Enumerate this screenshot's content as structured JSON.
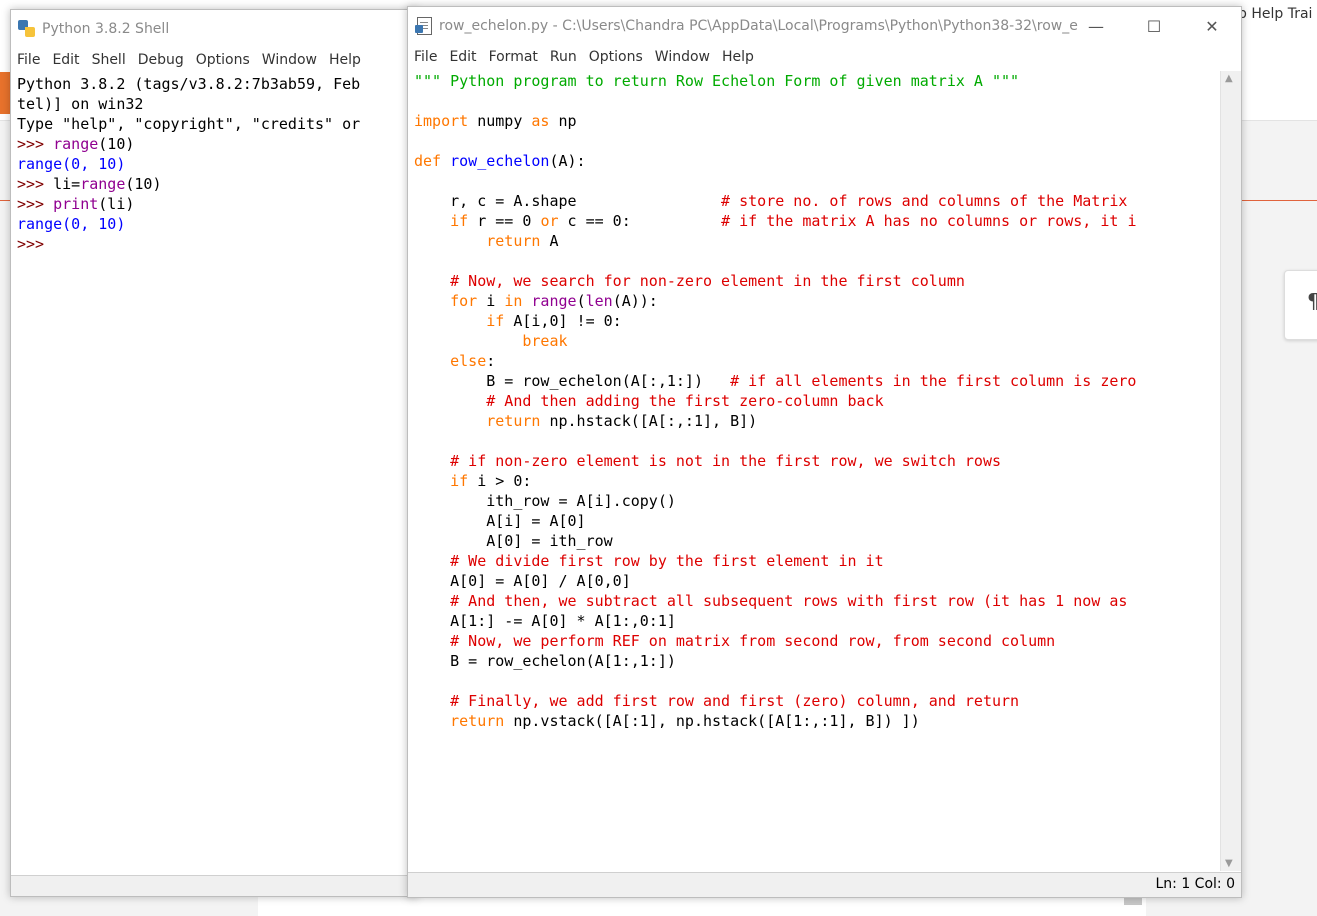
{
  "background": {
    "tab_partial": "p Help Trai",
    "pilcrow": "¶"
  },
  "shell": {
    "title": "Python 3.8.2 Shell",
    "menu": [
      "File",
      "Edit",
      "Shell",
      "Debug",
      "Options",
      "Window",
      "Help"
    ]
  },
  "editor": {
    "title": "row_echelon.py - C:\\Users\\Chandra PC\\AppData\\Local\\Programs\\Python\\Python38-32\\row_e...",
    "menu": [
      "File",
      "Edit",
      "Format",
      "Run",
      "Options",
      "Window",
      "Help"
    ],
    "status": "Ln: 1   Col: 0",
    "controls": {
      "minimize": "—",
      "maximize": "☐",
      "close": "✕"
    }
  },
  "shell_lines": [
    [
      [
        "",
        "Python 3.8.2 (tags/v3.8.2:7b3ab59, Feb"
      ]
    ],
    [
      [
        "",
        "tel)] on win32"
      ]
    ],
    [
      [
        "",
        "Type \"help\", \"copyright\", \"credits\" or"
      ]
    ],
    [
      [
        "pr",
        ">>> "
      ],
      [
        "bi",
        "range"
      ],
      [
        "",
        "(10)"
      ]
    ],
    [
      [
        "ou",
        "range(0, 10)"
      ]
    ],
    [
      [
        "pr",
        ">>> "
      ],
      [
        "",
        "li="
      ],
      [
        "bi",
        "range"
      ],
      [
        "",
        "(10)"
      ]
    ],
    [
      [
        "pr",
        ">>> "
      ],
      [
        "bi",
        "print"
      ],
      [
        "",
        "(li)"
      ]
    ],
    [
      [
        "ou",
        "range(0, 10)"
      ]
    ],
    [
      [
        "pr",
        ">>> "
      ]
    ]
  ],
  "code_lines": [
    [
      [
        "st",
        "\"\"\" Python program to return Row Echelon Form of given matrix A \"\"\""
      ]
    ],
    [],
    [
      [
        "kw",
        "import"
      ],
      [
        "",
        " numpy "
      ],
      [
        "kw",
        "as"
      ],
      [
        "",
        " np"
      ]
    ],
    [],
    [
      [
        "kw",
        "def"
      ],
      [
        "",
        " "
      ],
      [
        "df",
        "row_echelon"
      ],
      [
        "",
        "(A):"
      ]
    ],
    [],
    [
      [
        "",
        "    r, c = A.shape                "
      ],
      [
        "cm",
        "# store no. of rows and columns of the Matrix"
      ]
    ],
    [
      [
        "",
        "    "
      ],
      [
        "kw",
        "if"
      ],
      [
        "",
        " r == 0 "
      ],
      [
        "kw",
        "or"
      ],
      [
        "",
        " c == 0:          "
      ],
      [
        "cm",
        "# if the matrix A has no columns or rows, it i"
      ]
    ],
    [
      [
        "",
        "        "
      ],
      [
        "kw",
        "return"
      ],
      [
        "",
        " A"
      ]
    ],
    [],
    [
      [
        "",
        "    "
      ],
      [
        "cm",
        "# Now, we search for non-zero element in the first column"
      ]
    ],
    [
      [
        "",
        "    "
      ],
      [
        "kw",
        "for"
      ],
      [
        "",
        " i "
      ],
      [
        "kw",
        "in"
      ],
      [
        "",
        " "
      ],
      [
        "bi",
        "range"
      ],
      [
        "",
        "("
      ],
      [
        "bi",
        "len"
      ],
      [
        "",
        "(A)):"
      ]
    ],
    [
      [
        "",
        "        "
      ],
      [
        "kw",
        "if"
      ],
      [
        "",
        " A[i,0] != 0:"
      ]
    ],
    [
      [
        "",
        "            "
      ],
      [
        "kw",
        "break"
      ]
    ],
    [
      [
        "",
        "    "
      ],
      [
        "kw",
        "else"
      ],
      [
        "",
        ":"
      ]
    ],
    [
      [
        "",
        "        B = row_echelon(A[:,1:])   "
      ],
      [
        "cm",
        "# if all elements in the first column is zero"
      ]
    ],
    [
      [
        "",
        "        "
      ],
      [
        "cm",
        "# And then adding the first zero-column back"
      ]
    ],
    [
      [
        "",
        "        "
      ],
      [
        "kw",
        "return"
      ],
      [
        "",
        " np.hstack([A[:,:1], B])"
      ]
    ],
    [],
    [
      [
        "",
        "    "
      ],
      [
        "cm",
        "# if non-zero element is not in the first row, we switch rows"
      ]
    ],
    [
      [
        "",
        "    "
      ],
      [
        "kw",
        "if"
      ],
      [
        "",
        " i > 0:"
      ]
    ],
    [
      [
        "",
        "        ith_row = A[i].copy()"
      ]
    ],
    [
      [
        "",
        "        A[i] = A[0]"
      ]
    ],
    [
      [
        "",
        "        A[0] = ith_row"
      ]
    ],
    [
      [
        "",
        "    "
      ],
      [
        "cm",
        "# We divide first row by the first element in it"
      ]
    ],
    [
      [
        "",
        "    A[0] = A[0] / A[0,0]"
      ]
    ],
    [
      [
        "",
        "    "
      ],
      [
        "cm",
        "# And then, we subtract all subsequent rows with first row (it has 1 now as"
      ]
    ],
    [
      [
        "",
        "    A[1:] -= A[0] * A[1:,0:1]"
      ]
    ],
    [
      [
        "",
        "    "
      ],
      [
        "cm",
        "# Now, we perform REF on matrix from second row, from second column"
      ]
    ],
    [
      [
        "",
        "    B = row_echelon(A[1:,1:])"
      ]
    ],
    [],
    [
      [
        "",
        "    "
      ],
      [
        "cm",
        "# Finally, we add first row and first (zero) column, and return"
      ]
    ],
    [
      [
        "",
        "    "
      ],
      [
        "kw",
        "return"
      ],
      [
        "",
        " np.vstack([A[:1], np.hstack([A[1:,:1], B]) ])"
      ]
    ]
  ]
}
